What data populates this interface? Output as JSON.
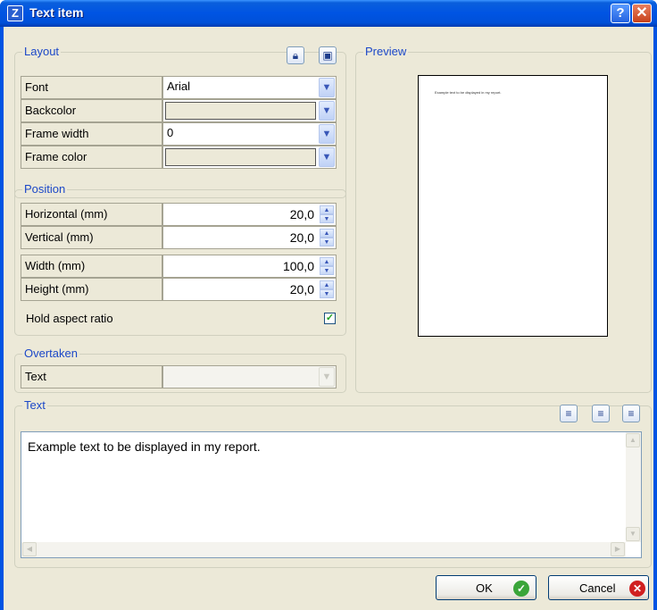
{
  "window": {
    "title": "Text item",
    "help_label": "?",
    "close_label": "✕"
  },
  "layout": {
    "group_label": "Layout",
    "rows": [
      {
        "label": "Font",
        "value": "Arial"
      },
      {
        "label": "Backcolor",
        "value": ""
      },
      {
        "label": "Frame width",
        "value": "0"
      },
      {
        "label": "Frame color",
        "value": ""
      }
    ]
  },
  "position": {
    "group_label": "Position",
    "rows": [
      {
        "label": "Horizontal (mm)",
        "value": "20,0"
      },
      {
        "label": "Vertical (mm)",
        "value": "20,0"
      },
      {
        "label": "Width (mm)",
        "value": "100,0"
      },
      {
        "label": "Height (mm)",
        "value": "20,0"
      }
    ],
    "hold_aspect_label": "Hold aspect ratio",
    "hold_aspect_checked": true
  },
  "overtaken": {
    "group_label": "Overtaken",
    "text_label": "Text",
    "text_value": ""
  },
  "preview": {
    "group_label": "Preview",
    "page_text": "Example text to be displayed in my report."
  },
  "text": {
    "group_label": "Text",
    "content": "Example text to be displayed in my report."
  },
  "buttons": {
    "ok": "OK",
    "cancel": "Cancel"
  },
  "colors": {
    "accent": "#1c48c8",
    "titlebar": "#0054e3",
    "ok_icon": "#3aa53a",
    "cancel_icon": "#d02020"
  },
  "icons": [
    "shield-icon",
    "save-icon",
    "align-left-icon",
    "align-center-icon",
    "align-right-icon",
    "check-icon",
    "cancel-icon"
  ]
}
